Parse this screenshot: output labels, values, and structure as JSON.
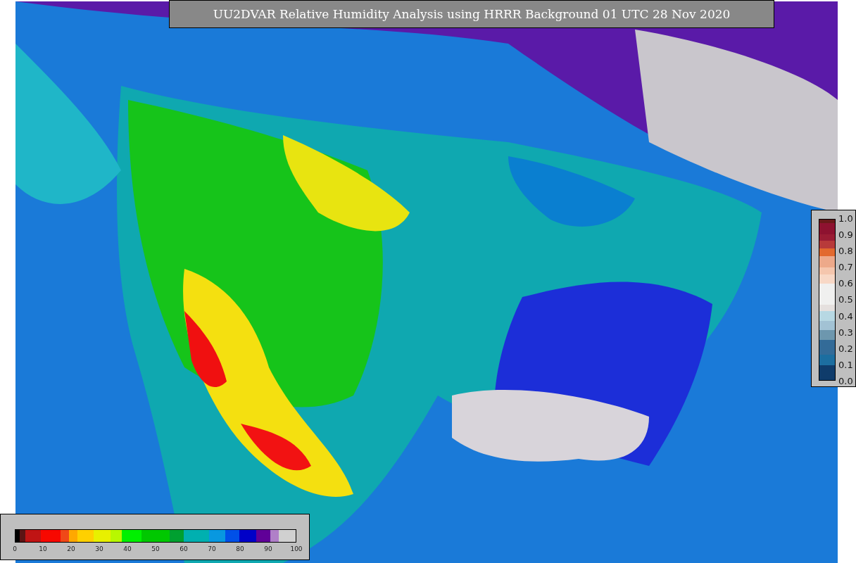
{
  "title": "UU2DVAR Relative Humidity Analysis using HRRR Background 01 UTC 28 Nov 2020",
  "side_legend": {
    "ticks": [
      "1.0",
      "0.9",
      "0.8",
      "0.7",
      "0.6",
      "0.5",
      "0.4",
      "0.3",
      "0.2",
      "0.1",
      "0.0"
    ]
  },
  "bottom_legend": {
    "ticks": [
      "0",
      "10",
      "20",
      "30",
      "40",
      "50",
      "60",
      "70",
      "80",
      "90",
      "100"
    ]
  }
}
